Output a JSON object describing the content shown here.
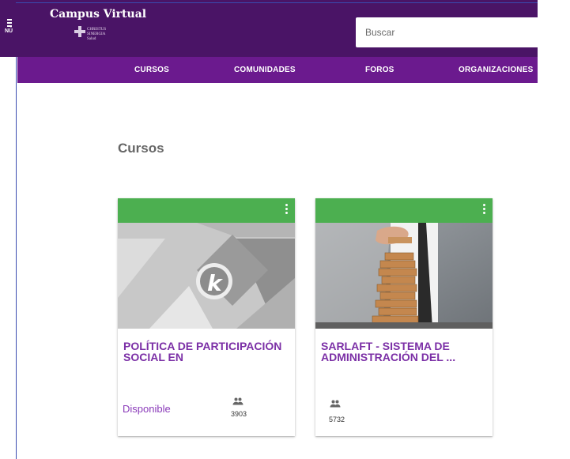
{
  "header": {
    "menu_label": "NÚ",
    "title": "Campus Virtual",
    "logo_lines": [
      "CHRISTUS",
      "SINERGIA",
      "Salud"
    ],
    "search_placeholder": "Buscar"
  },
  "nav": {
    "items": [
      "CURSOS",
      "COMUNIDADES",
      "FOROS",
      "ORGANIZACIONES"
    ]
  },
  "main": {
    "section_title": "Cursos",
    "cards": [
      {
        "title": "POLÍTICA DE PARTICIPACIÓN SOCIAL EN",
        "status": "Disponible",
        "members_count": "3903",
        "image_icon": "k-logo-icon"
      },
      {
        "title": "SARLAFT - SISTEMA DE ADMINISTRACIÓN DEL ...",
        "status": "",
        "members_count": "5732",
        "image_icon": "jenga-blocks-photo"
      }
    ]
  },
  "colors": {
    "header_bg": "#4a1466",
    "nav_bg": "#6b1a8e",
    "card_header": "#4caf50",
    "card_title": "#7b2fa6"
  }
}
